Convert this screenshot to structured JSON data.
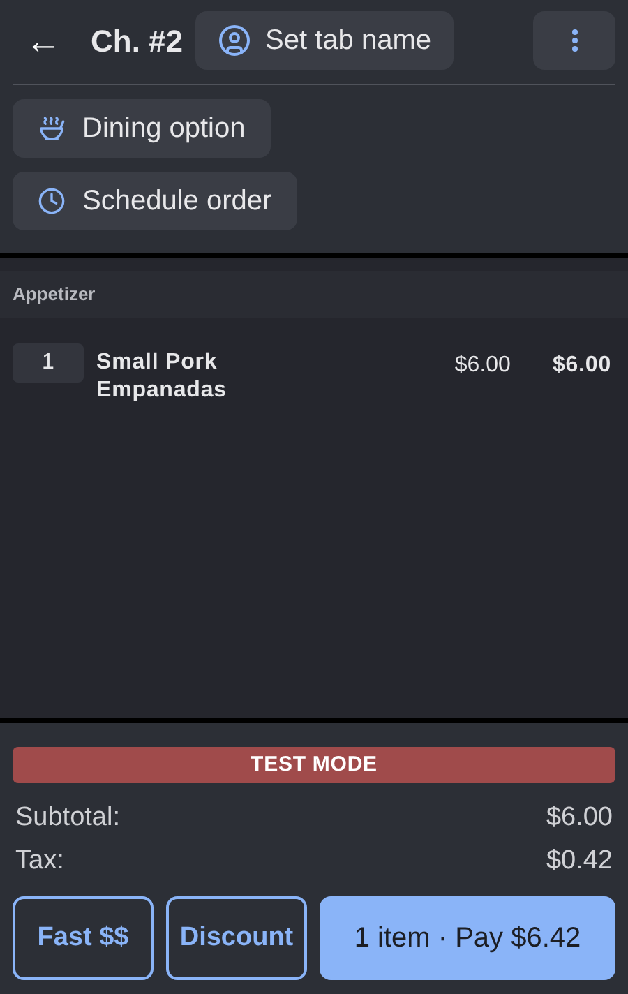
{
  "header": {
    "back": "←",
    "title": "Ch. #2",
    "tab_button": "Set tab name"
  },
  "options": [
    {
      "kind": "dining",
      "label": "Dining option"
    },
    {
      "kind": "schedule",
      "label": "Schedule order"
    }
  ],
  "categories": [
    {
      "name": "Appetizer",
      "items": [
        {
          "qty": "1",
          "name": "Small Pork Empanadas",
          "price": "$6.00",
          "total": "$6.00"
        }
      ]
    }
  ],
  "test_banner": "TEST MODE",
  "totals": [
    {
      "label": "Subtotal:",
      "value": "$6.00"
    },
    {
      "label": "Tax:",
      "value": "$0.42"
    }
  ],
  "actions": [
    {
      "kind": "outline",
      "label": "Fast $$"
    },
    {
      "kind": "outline",
      "label": "Discount"
    },
    {
      "kind": "primary",
      "label": "1 item · Pay $6.42"
    }
  ]
}
